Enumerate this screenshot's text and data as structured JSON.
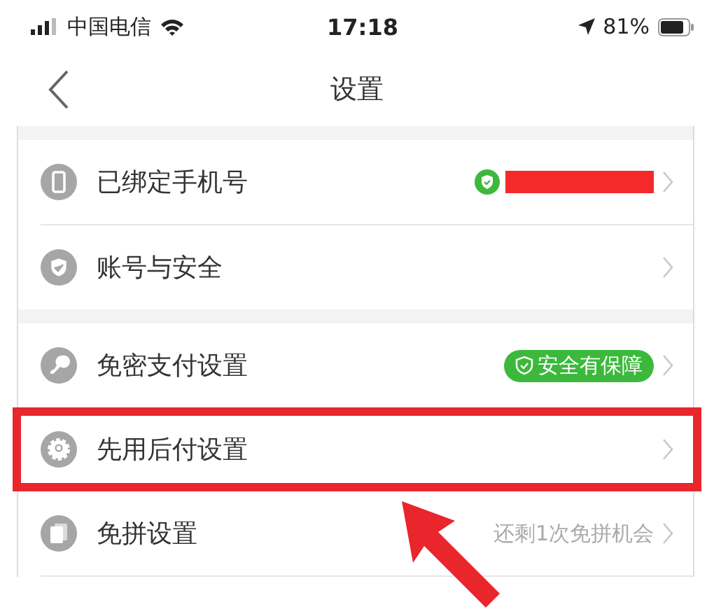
{
  "status_bar": {
    "carrier": "中国电信",
    "time": "17:18",
    "battery": "81%"
  },
  "nav": {
    "title": "设置"
  },
  "groups": [
    {
      "rows": [
        {
          "kind": "phone",
          "label": "已绑定手机号",
          "redacted": true,
          "highlighted": false
        },
        {
          "kind": "shield",
          "label": "账号与安全",
          "highlighted": false
        }
      ]
    },
    {
      "rows": [
        {
          "kind": "key",
          "label": "免密支付设置",
          "badge": true,
          "value": "安全有保障",
          "highlighted": false
        },
        {
          "kind": "gear",
          "label": "先用后付设置",
          "highlighted": true
        },
        {
          "kind": "card",
          "label": "免拼设置",
          "badge": false,
          "value": "还剩1次免拼机会",
          "highlighted": false
        }
      ]
    }
  ]
}
